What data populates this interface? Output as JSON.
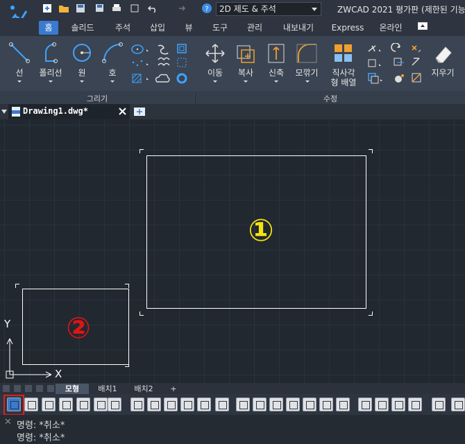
{
  "title_bar": {
    "workspace": "2D 제도 & 주석",
    "app_title": "ZWCAD 2021 평가판 (제한된 기능"
  },
  "ribbon_tabs": [
    "홈",
    "솔리드",
    "주석",
    "삽입",
    "뷰",
    "도구",
    "관리",
    "내보내기",
    "Express",
    "온라인"
  ],
  "ribbon": {
    "draw_buttons": [
      "선",
      "폴리선",
      "원",
      "호"
    ],
    "modify_buttons": [
      "이동",
      "복사",
      "신축",
      "모깎기"
    ],
    "array_button": [
      "직사각",
      "형 배열"
    ],
    "erase_button": "지우기",
    "panels": [
      "그리기",
      "수정"
    ]
  },
  "document": {
    "tab_label": "Drawing1.dwg*"
  },
  "canvas": {
    "label_1": "①",
    "label_2": "②",
    "axis_x": "X",
    "axis_y": "Y"
  },
  "layout_tabs": [
    "모형",
    "배치1",
    "배치2",
    "+"
  ],
  "command": {
    "lines": [
      "명령: *취소*",
      "명령: *취소*"
    ]
  },
  "colors": {
    "label_1": "#f5e310",
    "label_2": "#e01414",
    "accent": "#3a7ad1",
    "highlight": "#e02020"
  }
}
